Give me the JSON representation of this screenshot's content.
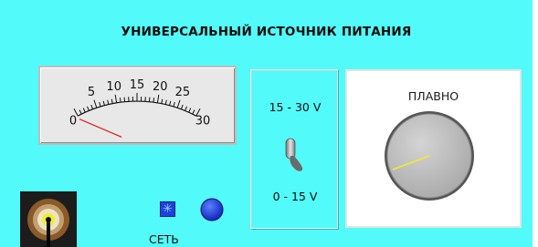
{
  "title": "УНИВЕРСАЛЬНЫЙ ИСТОЧНИК ПИТАНИЯ",
  "meter": {
    "tick_labels": [
      "0",
      "5",
      "10",
      "15",
      "20",
      "25",
      "30"
    ],
    "needle_value": 0,
    "min": 0,
    "max": 30
  },
  "range_switch": {
    "upper_label": "15 - 30 V",
    "lower_label": "0 - 15 V",
    "position": "lower"
  },
  "knob": {
    "label": "ПЛАВНО"
  },
  "power": {
    "label": "СЕТЬ",
    "icon": "snowflake-icon"
  },
  "colors": {
    "panel": "#52fafa",
    "needle": "#e02020",
    "indicator": "#f0ec30",
    "power_button": "#1e43d8",
    "led": "#1030e0"
  }
}
